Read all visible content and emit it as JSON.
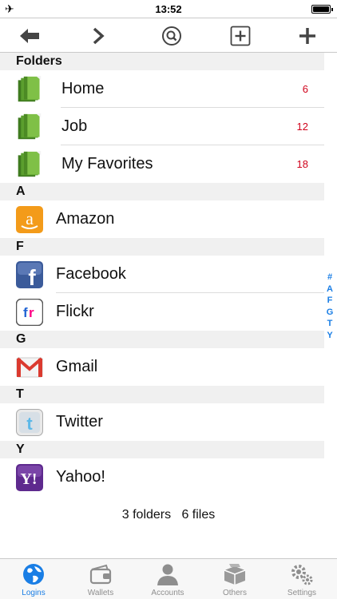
{
  "status_bar": {
    "time": "13:52",
    "airplane_icon": "airplane-icon",
    "battery_icon": "battery-icon"
  },
  "toolbar": {
    "buttons": [
      {
        "icon": "back-arrow-icon"
      },
      {
        "icon": "forward-chevron-icon"
      },
      {
        "icon": "search-circle-icon"
      },
      {
        "icon": "add-box-icon"
      },
      {
        "icon": "plus-icon"
      }
    ]
  },
  "sections": {
    "folders": "Folders",
    "a": "A",
    "f": "F",
    "g": "G",
    "t": "T",
    "y": "Y"
  },
  "folders": [
    {
      "name": "Home",
      "count": "6"
    },
    {
      "name": "Job",
      "count": "12"
    },
    {
      "name": "My Favorites",
      "count": "18"
    }
  ],
  "logins": {
    "amazon": "Amazon",
    "facebook": "Facebook",
    "flickr": "Flickr",
    "gmail": "Gmail",
    "twitter": "Twitter",
    "yahoo": "Yahoo!"
  },
  "index_letters": [
    "#",
    "A",
    "F",
    "G",
    "T",
    "Y"
  ],
  "summary": "3 folders   6 files",
  "tabs": [
    {
      "label": "Logins",
      "icon": "globe-icon"
    },
    {
      "label": "Wallets",
      "icon": "wallet-icon"
    },
    {
      "label": "Accounts",
      "icon": "person-icon"
    },
    {
      "label": "Others",
      "icon": "boxes-icon"
    },
    {
      "label": "Settings",
      "icon": "gears-icon"
    }
  ],
  "colors": {
    "accent": "#1a7ee5",
    "count": "#d0021b",
    "section_bg": "#f0f0f0"
  }
}
